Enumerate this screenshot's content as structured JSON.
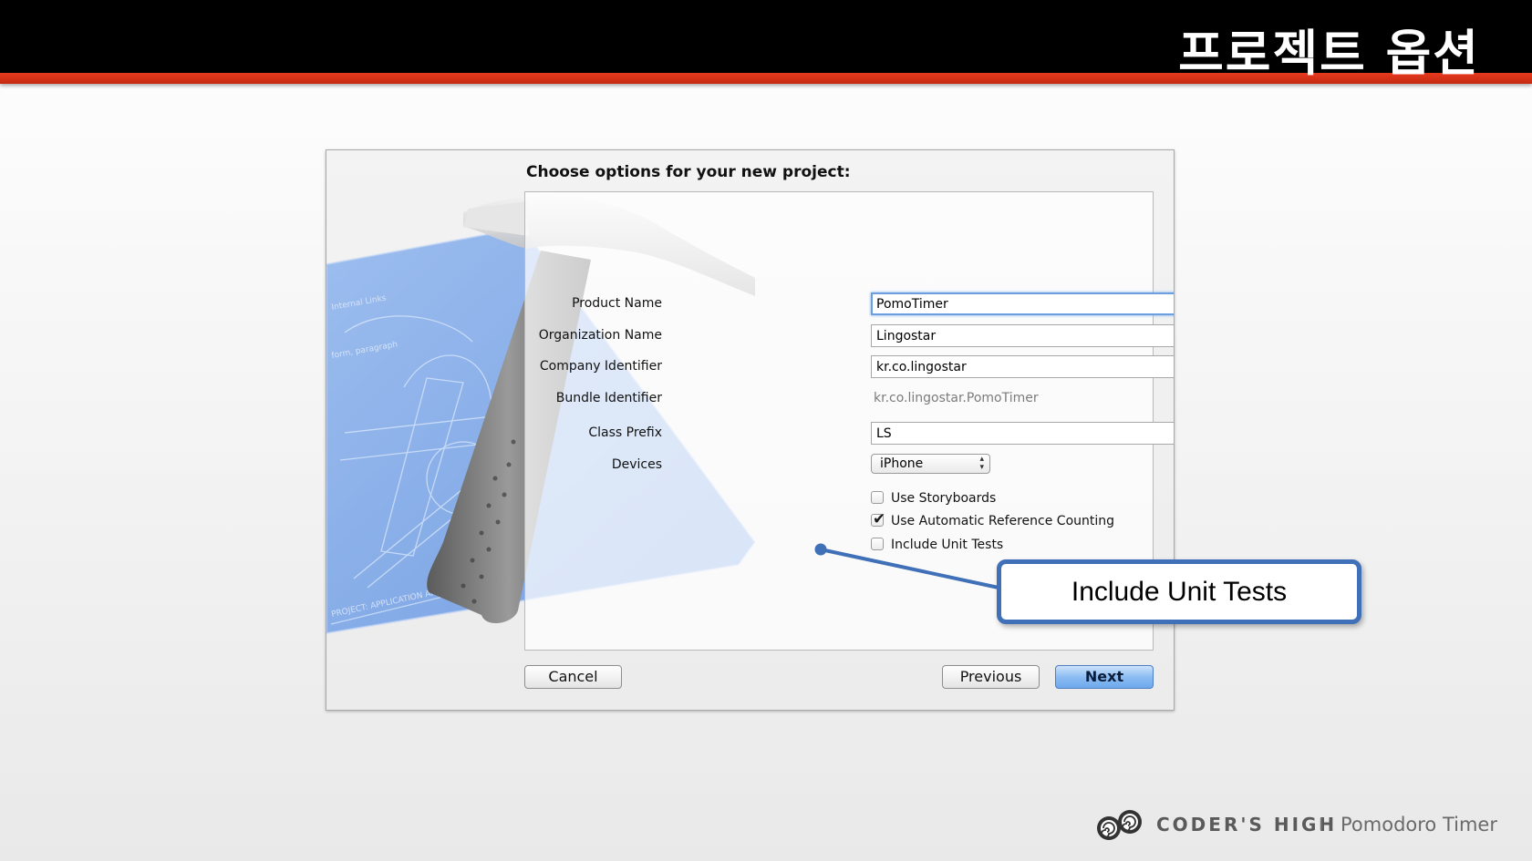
{
  "slide": {
    "title": "프로젝트 옵션"
  },
  "dialog": {
    "heading": "Choose options for your new project:",
    "fields": {
      "product_name": {
        "label": "Product Name",
        "value": "PomoTimer"
      },
      "organization_name": {
        "label": "Organization Name",
        "value": "Lingostar"
      },
      "company_identifier": {
        "label": "Company Identifier",
        "value": "kr.co.lingostar"
      },
      "bundle_identifier": {
        "label": "Bundle Identifier",
        "value": "kr.co.lingostar.PomoTimer"
      },
      "class_prefix": {
        "label": "Class Prefix",
        "value": "LS"
      },
      "devices": {
        "label": "Devices",
        "value": "iPhone"
      }
    },
    "options": [
      {
        "label": "Use Storyboards",
        "checked": false
      },
      {
        "label": "Use Automatic Reference Counting",
        "checked": true
      },
      {
        "label": "Include Unit Tests",
        "checked": false
      }
    ],
    "buttons": {
      "cancel": "Cancel",
      "previous": "Previous",
      "next": "Next"
    }
  },
  "callout": {
    "text": "Include Unit Tests"
  },
  "footer": {
    "brand": "CODER'S HIGH",
    "separator": "I",
    "project": "Pomodoro Timer"
  },
  "colors": {
    "title_bar": "#000000",
    "accent_stripe": "#d93218",
    "callout_border": "#3f70b8",
    "primary_button": "#8cbcf2"
  }
}
